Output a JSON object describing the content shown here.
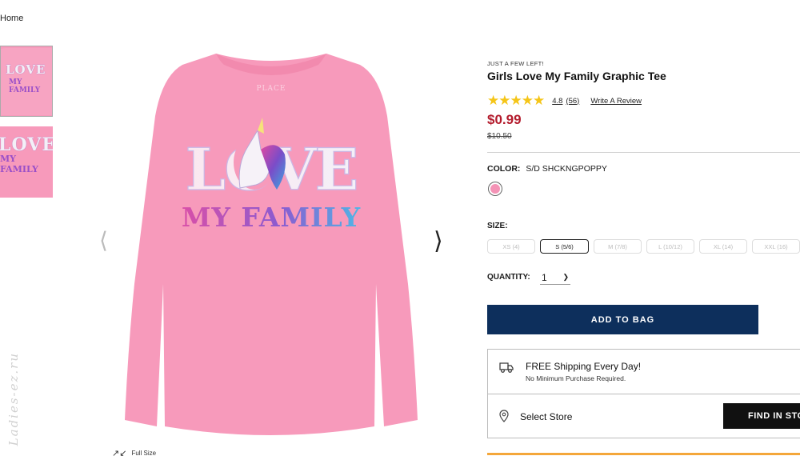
{
  "breadcrumb": {
    "home": "Home"
  },
  "thumbnails": [
    {
      "text_line1": "LOVE",
      "text_line2": "MY FAMILY"
    },
    {
      "text_line1": "LOVE",
      "text_line2": "MY FAMILY"
    }
  ],
  "main_image": {
    "graphic_line1": "LOVE",
    "graphic_line2": "MY FAMILY",
    "brand_tag": "PLACE",
    "shirt_color": "#f79abb"
  },
  "gallery": {
    "prev_icon": "chevron-left-icon",
    "next_icon": "chevron-right-icon",
    "full_size_label": "Full Size"
  },
  "watermark": "Ladies-ez.ru",
  "product": {
    "stock_note": "JUST A FEW LEFT!",
    "title": "Girls Love My Family Graphic Tee",
    "rating": "4.8",
    "review_count": "(56)",
    "write_review": "Write A Review",
    "price": "$0.99",
    "original_price": "$10.50",
    "price_color": "#b31b2c"
  },
  "color": {
    "label": "COLOR:",
    "value": "S/D SHCKNGPOPPY",
    "swatch_hex": "#f493b6"
  },
  "size": {
    "label": "SIZE:",
    "options": [
      "XS (4)",
      "S (5/6)",
      "M (7/8)",
      "L (10/12)",
      "XL (14)",
      "XXL (16)"
    ],
    "selected": "S (5/6)"
  },
  "quantity": {
    "label": "QUANTITY:",
    "value": "1"
  },
  "add_to_bag": {
    "label": "ADD TO BAG",
    "color": "#0d2f5c"
  },
  "shipping": {
    "title": "FREE Shipping Every Day!",
    "subtitle": "No Minimum Purchase Required."
  },
  "store": {
    "label": "Select Store",
    "find_button": "FIND IN STORE"
  }
}
